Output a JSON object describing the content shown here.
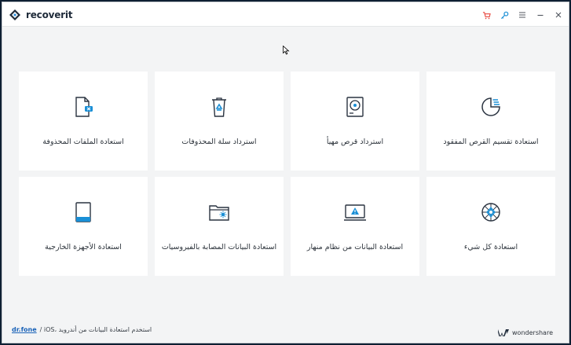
{
  "app": {
    "title": "recoverit"
  },
  "titlebar": {
    "cart_icon": "cart-icon",
    "key_icon": "key-icon",
    "menu_icon": "menu-icon",
    "minimize_icon": "minimize-icon",
    "close_icon": "close-icon",
    "accent_cart": "#e8453c",
    "accent_key": "#1a8fd6"
  },
  "cards": [
    {
      "label": "استعادة الملفات المحذوفة",
      "icon": "deleted-file-icon"
    },
    {
      "label": "استرداد سلة المحذوفات",
      "icon": "recycle-bin-icon"
    },
    {
      "label": "استرداد قرص مهيأ",
      "icon": "formatted-disk-icon"
    },
    {
      "label": "استعادة تقسيم القرص المفقود",
      "icon": "lost-partition-icon"
    },
    {
      "label": "استعادة الأجهزة الخارجية",
      "icon": "external-device-icon"
    },
    {
      "label": "استعادة البيانات المصابة بالفيروسيات",
      "icon": "virus-folder-icon"
    },
    {
      "label": "استعادة البيانات من نظام منهار",
      "icon": "crashed-system-icon"
    },
    {
      "label": "استعادة كل شيء",
      "icon": "all-around-icon"
    }
  ],
  "footer": {
    "link": "dr.fone",
    "text": "/ iOS، استخدم  استعادة البيانات من أندرويد",
    "brand": "wondershare"
  }
}
